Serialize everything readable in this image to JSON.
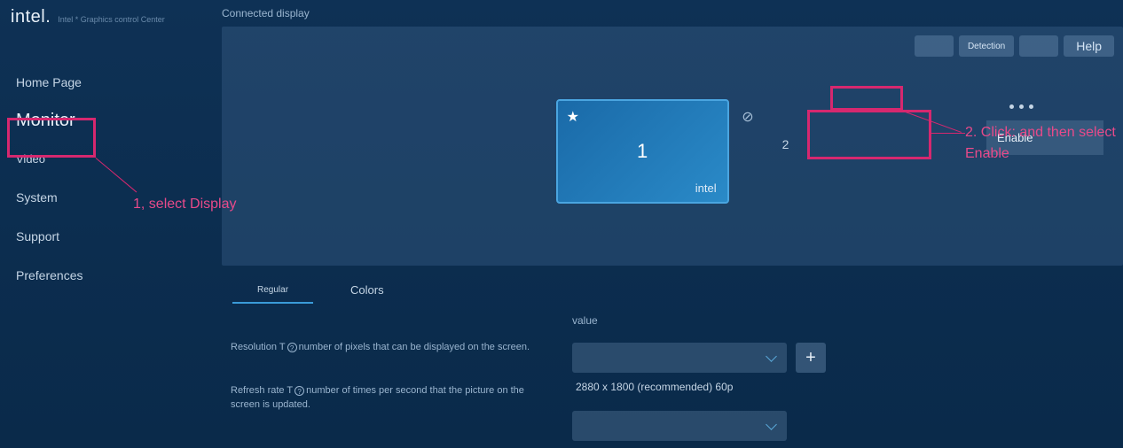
{
  "brand": {
    "name": "intel.",
    "sub": "Intel * Graphics control Center"
  },
  "sidebar": {
    "items": [
      {
        "label": "Home Page"
      },
      {
        "label": "Monitor"
      },
      {
        "label": "Video"
      },
      {
        "label": "System"
      },
      {
        "label": "Support"
      },
      {
        "label": "Preferences"
      }
    ]
  },
  "main": {
    "section_title": "Connected display",
    "top_buttons": {
      "detection": "Detection",
      "help": "Help"
    },
    "display1": {
      "num": "1",
      "label": "intel"
    },
    "display2": {
      "num": "2"
    },
    "menu": {
      "enable": "Enable"
    },
    "tabs": {
      "regular": "Regular",
      "colors": "Colors"
    },
    "settings": {
      "value_header": "value",
      "resolution": {
        "label_a": "Resolution T",
        "label_b": "number of pixels that can be displayed on the screen.",
        "value": "2880 x 1800 (recommended) 60p"
      },
      "refresh": {
        "label_a": "Refresh rate T",
        "label_b": "number of times per second that the picture on the screen is updated."
      }
    }
  },
  "annotations": {
    "step1": "1, select Display",
    "step2": "2. Click: and then select Enable"
  }
}
